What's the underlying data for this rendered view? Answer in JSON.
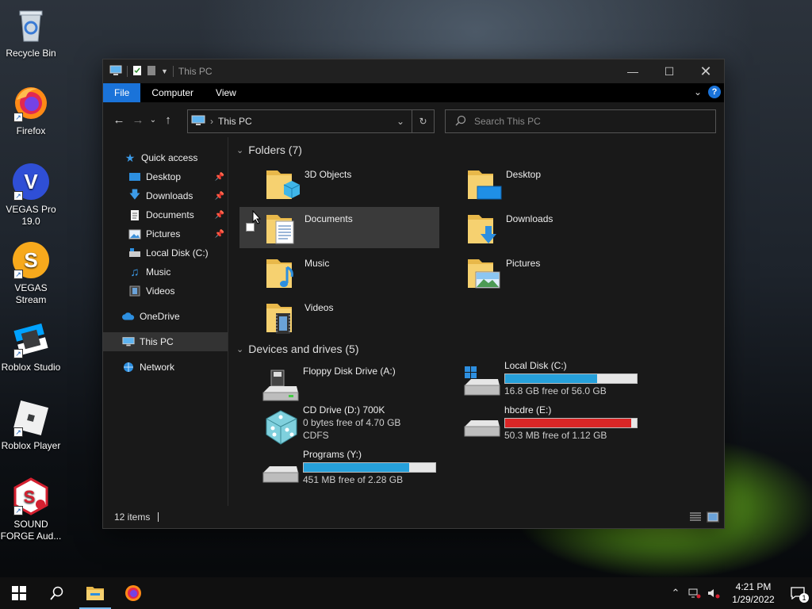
{
  "desktop": {
    "icons": [
      {
        "label": "Recycle Bin"
      },
      {
        "label": "Firefox"
      },
      {
        "label": "VEGAS Pro 19.0"
      },
      {
        "label": "VEGAS Stream"
      },
      {
        "label": "Roblox Studio"
      },
      {
        "label": "Roblox Player"
      },
      {
        "label": "SOUND FORGE Aud..."
      }
    ]
  },
  "window": {
    "title": "This PC",
    "ribbon_tabs": [
      "File",
      "Computer",
      "View"
    ],
    "address": {
      "crumb": "This PC"
    },
    "search": {
      "placeholder": "Search This PC"
    },
    "nav": {
      "quick_access": "Quick access",
      "items": [
        {
          "label": "Desktop",
          "pinned": true
        },
        {
          "label": "Downloads",
          "pinned": true
        },
        {
          "label": "Documents",
          "pinned": true
        },
        {
          "label": "Pictures",
          "pinned": true
        },
        {
          "label": "Local Disk (C:)",
          "pinned": false
        },
        {
          "label": "Music",
          "pinned": false
        },
        {
          "label": "Videos",
          "pinned": false
        }
      ],
      "onedrive": "OneDrive",
      "this_pc": "This PC",
      "network": "Network"
    },
    "folders": {
      "header": "Folders (7)",
      "items": [
        "3D Objects",
        "Desktop",
        "Documents",
        "Downloads",
        "Music",
        "Pictures",
        "Videos"
      ]
    },
    "drives": {
      "header": "Devices and drives (5)",
      "floppy": {
        "name": "Floppy Disk Drive (A:)"
      },
      "local_c": {
        "name": "Local Disk (C:)",
        "free": "16.8 GB free of 56.0 GB",
        "used_fraction": 0.7
      },
      "cd": {
        "name": "CD Drive (D:) 700K",
        "free": "0 bytes free of 4.70 GB",
        "fs": "CDFS"
      },
      "hbcdre": {
        "name": "hbcdre (E:)",
        "free": "50.3 MB free of 1.12 GB",
        "used_fraction": 0.96
      },
      "programs": {
        "name": "Programs (Y:)",
        "free": "451 MB free of 2.28 GB",
        "used_fraction": 0.8
      }
    },
    "status": {
      "items": "12 items"
    }
  },
  "taskbar": {
    "time": "4:21 PM",
    "date": "1/29/2022",
    "notification_count": "1"
  },
  "colors": {
    "accent": "#1a73d9",
    "bar_blue": "#26a0da",
    "bar_red": "#da2626"
  }
}
